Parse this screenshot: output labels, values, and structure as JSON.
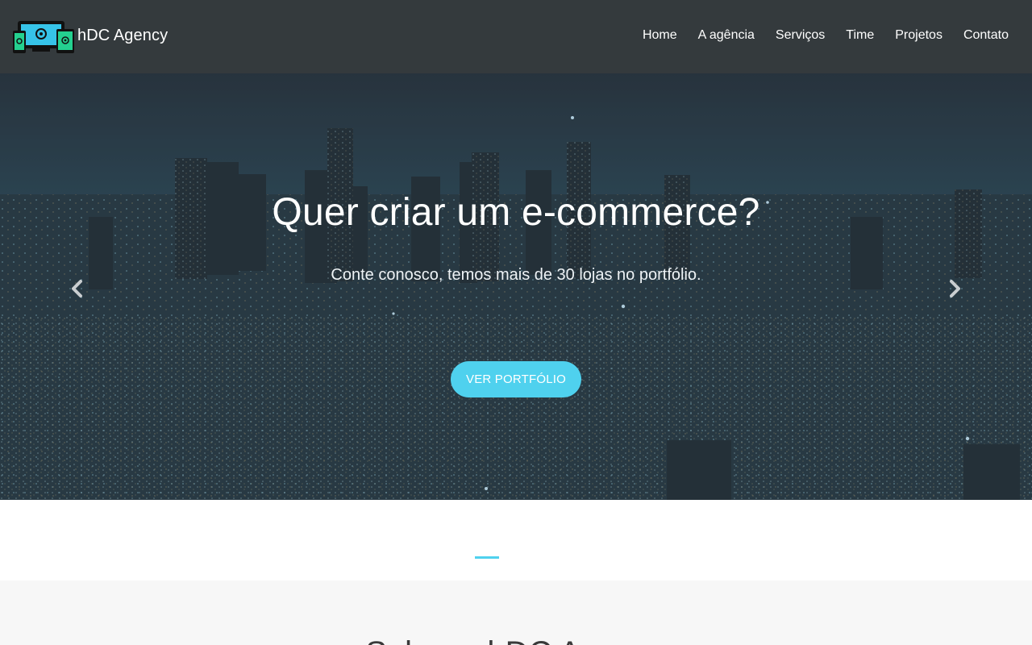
{
  "brand": {
    "name": "hDC Agency",
    "logo_icon": "devices-logo-icon"
  },
  "nav": {
    "items": [
      "Home",
      "A agência",
      "Serviços",
      "Time",
      "Projetos",
      "Contato"
    ]
  },
  "hero": {
    "title": "Quer criar um e-commerce?",
    "subtitle": "Conte conosco, temos mais de 30 lojas no portfólio.",
    "button_label": "VER PORTFÓLIO",
    "prev_icon": "chevron-left-icon",
    "next_icon": "chevron-right-icon"
  },
  "section": {
    "heading": "Sobre a hDC Agency"
  },
  "colors": {
    "accent": "#4fd1ee",
    "navbar": "#343a3d",
    "section_gray": "#f7f7f7"
  }
}
